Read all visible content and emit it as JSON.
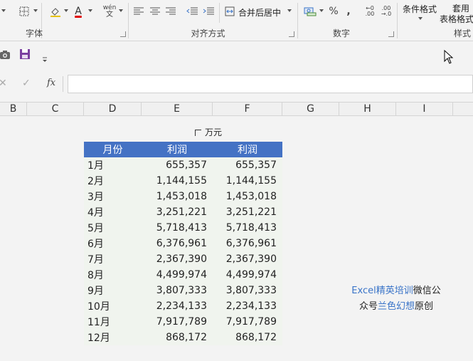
{
  "ribbon": {
    "groups": {
      "font": "字体",
      "alignment": "对齐方式",
      "number": "数字",
      "styles": "样式"
    },
    "merge_center": "合并后居中",
    "conditional_format": "条件格式",
    "table_format_1": "套用",
    "table_format_2": "表格格式",
    "percent": "%",
    "comma": ",",
    "phonetic": "wén",
    "font_color": "A"
  },
  "formula_bar": {
    "fx": "fx",
    "value": ""
  },
  "columns": [
    "B",
    "C",
    "D",
    "E",
    "F",
    "G",
    "H",
    "I"
  ],
  "sheet": {
    "unit_label": "万元",
    "headers": [
      "月份",
      "利润",
      "利润"
    ],
    "rows": [
      {
        "month": "1月",
        "e": "655,357",
        "f": "655,357"
      },
      {
        "month": "2月",
        "e": "1,144,155",
        "f": "1,144,155"
      },
      {
        "month": "3月",
        "e": "1,453,018",
        "f": "1,453,018"
      },
      {
        "month": "4月",
        "e": "3,251,221",
        "f": "3,251,221"
      },
      {
        "month": "5月",
        "e": "5,718,413",
        "f": "5,718,413"
      },
      {
        "month": "6月",
        "e": "6,376,961",
        "f": "6,376,961"
      },
      {
        "month": "7月",
        "e": "2,367,390",
        "f": "2,367,390"
      },
      {
        "month": "8月",
        "e": "4,499,974",
        "f": "4,499,974"
      },
      {
        "month": "9月",
        "e": "3,807,333",
        "f": "3,807,333"
      },
      {
        "month": "10月",
        "e": "2,234,133",
        "f": "2,234,133"
      },
      {
        "month": "11月",
        "e": "7,917,789",
        "f": "7,917,789"
      },
      {
        "month": "12月",
        "e": "868,172",
        "f": "868,172"
      }
    ]
  },
  "credit": {
    "part1": "Excel精英培训",
    "part2": "微信公",
    "part3": "众号",
    "part4": "兰色幻想",
    "part5": "原创"
  },
  "colors": {
    "header_blue": "#4472c4",
    "credit_blue": "#3a74c8",
    "save_purple": "#7a3fa0"
  }
}
